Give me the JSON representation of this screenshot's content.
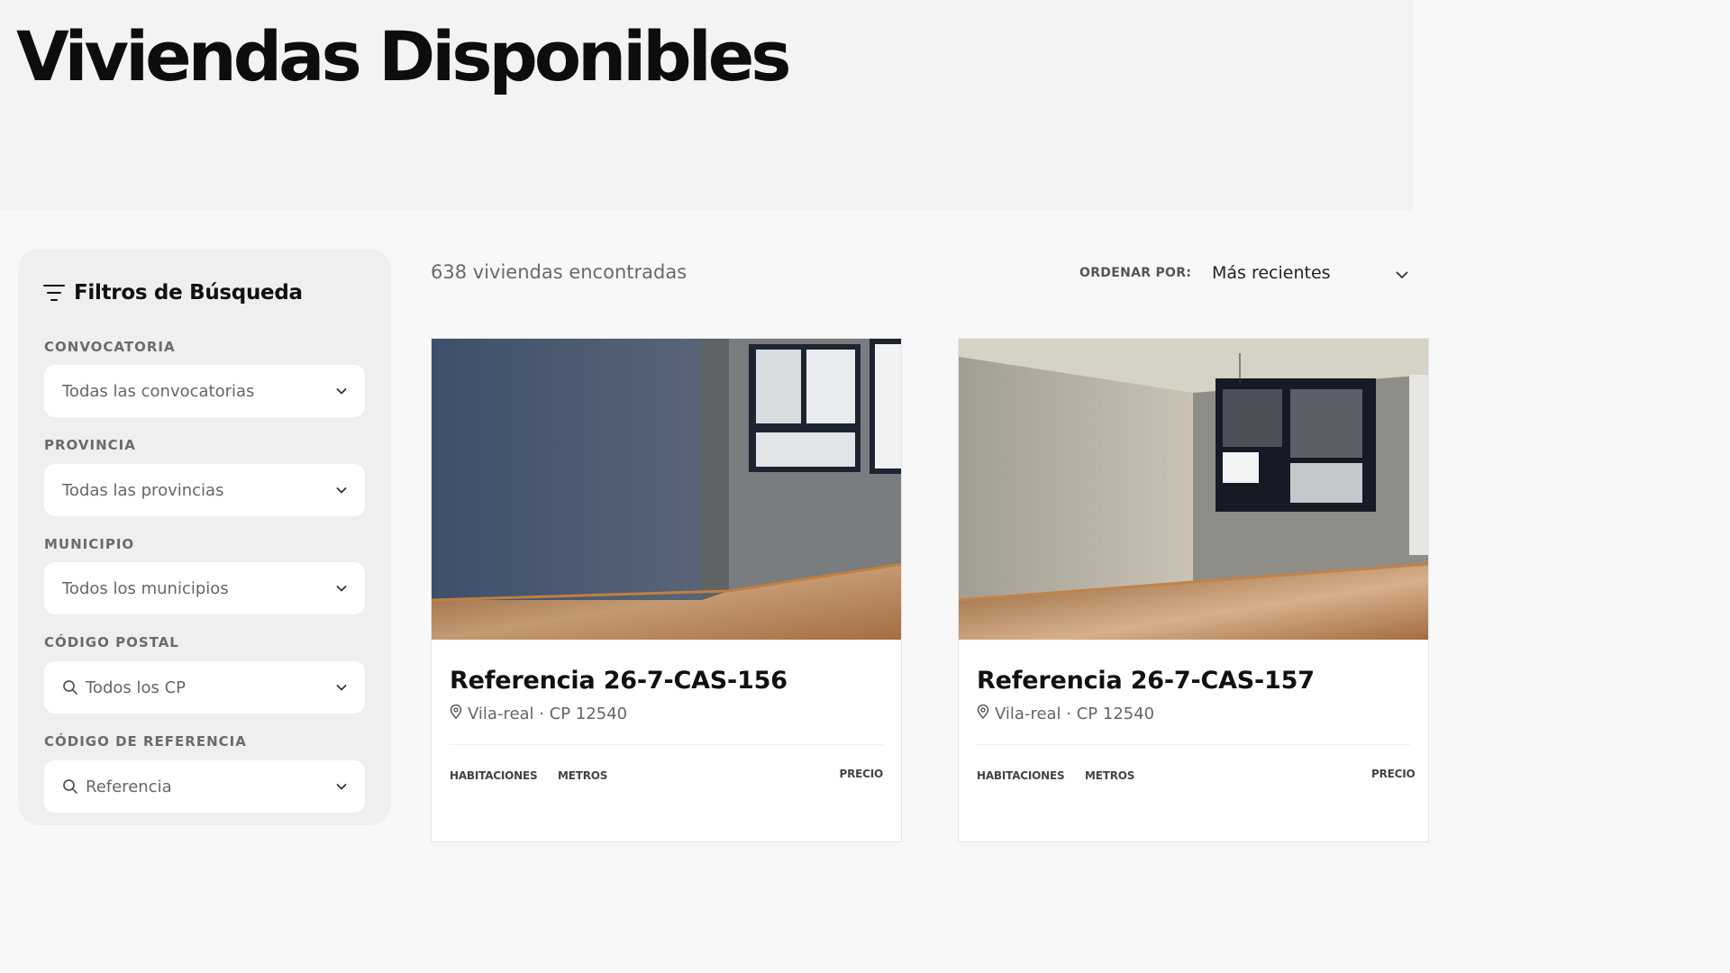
{
  "page": {
    "title": "Viviendas Disponibles"
  },
  "filters": {
    "title": "Filtros de Búsqueda",
    "convocatoria": {
      "label": "CONVOCATORIA",
      "value": "Todas las convocatorias"
    },
    "provincia": {
      "label": "PROVINCIA",
      "value": "Todas las provincias"
    },
    "municipio": {
      "label": "MUNICIPIO",
      "value": "Todos los municipios"
    },
    "codigo_postal": {
      "label": "CÓDIGO POSTAL",
      "value": "Todos los CP"
    },
    "codigo_referencia": {
      "label": "CÓDIGO DE REFERENCIA",
      "value": "Referencia"
    }
  },
  "results": {
    "count_text": "638 viviendas encontradas",
    "sort_label": "ORDENAR POR:",
    "sort_value": "Más recientes"
  },
  "cards": [
    {
      "title": "Referencia 26-7-CAS-156",
      "location": "Vila-real · CP 12540",
      "rooms_label": "HABITACIONES",
      "meters_label": "METROS",
      "price_label": "PRECIO"
    },
    {
      "title": "Referencia 26-7-CAS-157",
      "location": "Vila-real · CP 12540",
      "rooms_label": "HABITACIONES",
      "meters_label": "METROS",
      "price_label": "PRECIO"
    }
  ],
  "icons": {
    "filter": "filter-lines-icon",
    "chevron": "chevron-down-icon",
    "search": "search-icon",
    "location": "map-pin-icon"
  },
  "colors": {
    "hero_bg": "#f3f3f3",
    "page_bg": "#f8f8f8",
    "sidebar_bg": "#efefef",
    "text_dark": "#111111",
    "label_gray": "#6b6b6b"
  }
}
